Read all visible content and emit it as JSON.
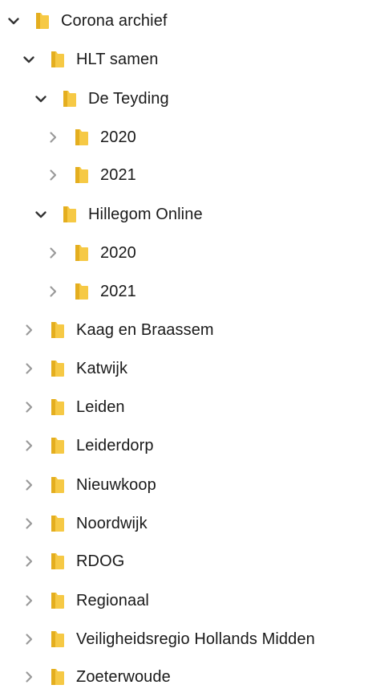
{
  "tree": {
    "root": {
      "label": "Corona archief",
      "expanded": true,
      "icon": "folder-icon"
    },
    "hlt_samen": {
      "label": "HLT samen",
      "expanded": true,
      "children": {
        "de_teyding": {
          "label": "De Teyding",
          "expanded": true,
          "children": [
            "2020",
            "2021"
          ]
        },
        "hillegom_online": {
          "label": "Hillegom Online",
          "expanded": true,
          "children": [
            "2020",
            "2021"
          ]
        }
      }
    },
    "siblings": [
      "Kaag en Braassem",
      "Katwijk",
      "Leiden",
      "Leiderdorp",
      "Nieuwkoop",
      "Noordwijk",
      "RDOG",
      "Regionaal",
      "Veiligheidsregio Hollands Midden",
      "Zoeterwoude"
    ]
  },
  "colors": {
    "folder_fill": "#f6c945",
    "folder_dark": "#e4ae1f",
    "chevron": "#333333",
    "chevron_collapsed": "#9a9a9a",
    "text": "#1a1a1a"
  }
}
